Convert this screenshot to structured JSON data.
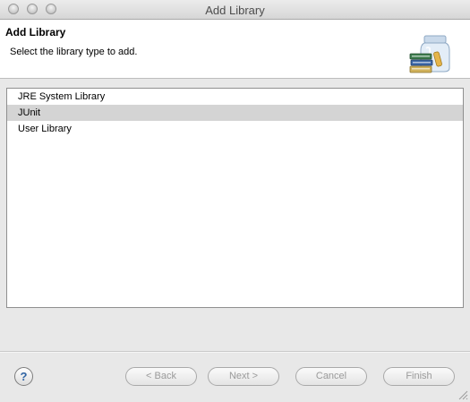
{
  "window": {
    "title": "Add Library"
  },
  "header": {
    "title": "Add Library",
    "description": "Select the library type to add.",
    "banner_icon": "library-jar-icon"
  },
  "library_types": {
    "items": [
      {
        "label": "JRE System Library",
        "selected": false
      },
      {
        "label": "JUnit",
        "selected": true
      },
      {
        "label": "User Library",
        "selected": false
      }
    ]
  },
  "footer": {
    "help_label": "?",
    "back_label": "< Back",
    "next_label": "Next >",
    "cancel_label": "Cancel",
    "finish_label": "Finish"
  },
  "colors": {
    "selection": "#d4d4d4",
    "help_accent": "#2e63a3",
    "disabled_text": "#9a9a9a"
  }
}
